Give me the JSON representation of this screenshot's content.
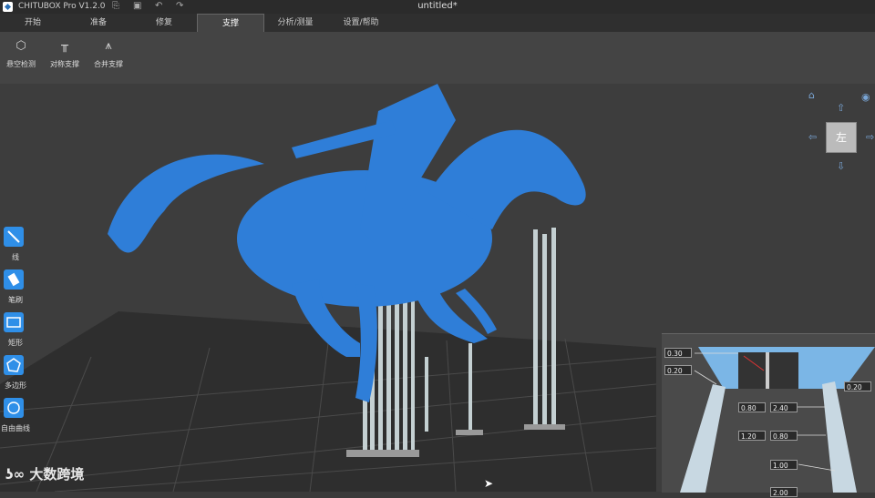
{
  "titlebar": {
    "app_title": "CHITUBOX Pro V1.2.0",
    "document_title": "untitled*"
  },
  "tabs": [
    "开始",
    "准备",
    "修复",
    "支撑",
    "分析/测量",
    "设置/帮助"
  ],
  "toolbar": {
    "overhang": "悬空检测",
    "symmetric": "对称支撑",
    "merge": "合并支撑"
  },
  "sidebar": {
    "line": "线",
    "brush": "笔刷",
    "rect": "矩形",
    "polygon": "多边形",
    "freeform": "自由曲线"
  },
  "view_cube": {
    "face": "左"
  },
  "support_panel": {
    "top_contact": "0.30",
    "top_depth": "0.20",
    "right_depth": "0.20",
    "upper_left": "0.80",
    "upper_right": "2.40",
    "middle_left": "1.20",
    "middle_right": "0.80",
    "lower": "1.00",
    "bottom": "2.00"
  },
  "watermark": "大数跨境",
  "colors": {
    "model": "#2f7ed8",
    "support": "#c4d0d2",
    "accent": "#2f8fe8"
  }
}
